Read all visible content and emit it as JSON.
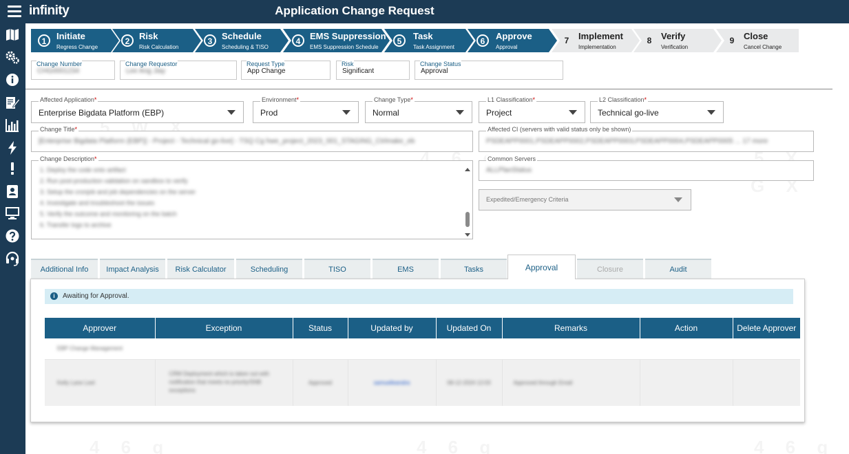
{
  "app": {
    "brand": "infinity",
    "title": "Application Change Request"
  },
  "nav": {
    "icons": [
      "menu-icon",
      "map-icon",
      "settings-icon",
      "info-icon",
      "edit-document-icon",
      "chart-icon",
      "lightning-icon",
      "alert-icon",
      "contacts-icon",
      "monitor-icon",
      "help-icon",
      "support-icon"
    ]
  },
  "steps": [
    {
      "num": "1",
      "title": "Initiate",
      "sub": "Regress Change",
      "state": "active"
    },
    {
      "num": "2",
      "title": "Risk",
      "sub": "Risk Calculation",
      "state": "active"
    },
    {
      "num": "3",
      "title": "Schedule",
      "sub": "Scheduling & TISO",
      "state": "active"
    },
    {
      "num": "4",
      "title": "EMS Suppression",
      "sub": "EMS Suppression Schedule",
      "state": "active"
    },
    {
      "num": "5",
      "title": "Task",
      "sub": "Task Assignment",
      "state": "active"
    },
    {
      "num": "6",
      "title": "Approve",
      "sub": "Approval",
      "state": "active"
    },
    {
      "num": "7",
      "title": "Implement",
      "sub": "Implementation",
      "state": "inactive"
    },
    {
      "num": "8",
      "title": "Verify",
      "sub": "Verification",
      "state": "inactive"
    },
    {
      "num": "9",
      "title": "Close",
      "sub": "Cancel Change",
      "state": "inactive"
    }
  ],
  "header": {
    "change_number": {
      "label": "Change Number",
      "value": "CHG0001234"
    },
    "change_requestor": {
      "label": "Change Requestor",
      "value": "Lee Ang Jiay"
    },
    "request_type": {
      "label": "Request Type",
      "value": "App Change"
    },
    "risk": {
      "label": "Risk",
      "value": "Significant"
    },
    "change_status": {
      "label": "Change Status",
      "value": "Approval"
    }
  },
  "form": {
    "affected_application": {
      "label": "Affected Application",
      "value": "Enterprise Bigdata Platform (EBP)"
    },
    "environment": {
      "label": "Environment",
      "value": "Prod"
    },
    "change_type": {
      "label": "Change Type",
      "value": "Normal"
    },
    "l1_classification": {
      "label": "L1 Classification",
      "value": "Project"
    },
    "l2_classification": {
      "label": "L2 Classification",
      "value": "Technical go-live"
    },
    "change_title": {
      "label": "Change Title",
      "value": "[Enterprise Bigdata Platform (EBP)] - Project - Technical go-live] - TSQ Cg hwe_project_2023_001_STAGING_Ctrlmake_eb"
    },
    "affected_ci": {
      "label": "Affected CI (servers with valid status only be shown)",
      "value": "PSDEAPP0001,PSDEAPP0002,PSDEAPP0003,PSDEAPP0004,PSDEAPP0005 ... 17 more"
    },
    "change_description": {
      "label": "Change Description",
      "lines": [
        "1. Deploy the code onto artifact",
        "2. Run post-production validation on sandbox to verify",
        "3. Setup the cronjob and job dependencies on the server",
        "4. Investigate and troubleshoot the issues",
        "5. Verify the outcome and monitoring on the batch",
        "6. Transfer logs to archive"
      ]
    },
    "common_servers": {
      "label": "Common Servers",
      "value": "ALLPlanStatus"
    },
    "expedited": {
      "label": "Expedited/Emergency Criteria"
    }
  },
  "tabs": [
    {
      "label": "Additional Info",
      "state": "normal"
    },
    {
      "label": "Impact Analysis",
      "state": "normal"
    },
    {
      "label": "Risk Calculator",
      "state": "normal"
    },
    {
      "label": "Scheduling",
      "state": "normal"
    },
    {
      "label": "TISO",
      "state": "normal"
    },
    {
      "label": "EMS",
      "state": "normal"
    },
    {
      "label": "Tasks",
      "state": "normal"
    },
    {
      "label": "Approval",
      "state": "active"
    },
    {
      "label": "Closure",
      "state": "disabled"
    },
    {
      "label": "Audit",
      "state": "normal"
    }
  ],
  "approval": {
    "alert": "Awaiting for Approval.",
    "columns": [
      "Approver",
      "Exception",
      "Status",
      "Updated by",
      "Updated On",
      "Remarks",
      "Action",
      "Delete Approver"
    ],
    "group_label": "EBP Change Management",
    "rows": [
      {
        "approver": "Kelly Lane Leel",
        "exception": "CRM Deployment which is taken out with notification that meets no priority/SNB exceptions",
        "status": "Approved",
        "updated_by": "samuelleandra",
        "updated_on": "08-12-2024 12:03",
        "remarks": "Approved through Email",
        "action": "",
        "delete": ""
      }
    ]
  },
  "colors": {
    "primary": "#1b5f86",
    "nav": "#1c3b55",
    "alert_bg": "#d6edf5"
  }
}
